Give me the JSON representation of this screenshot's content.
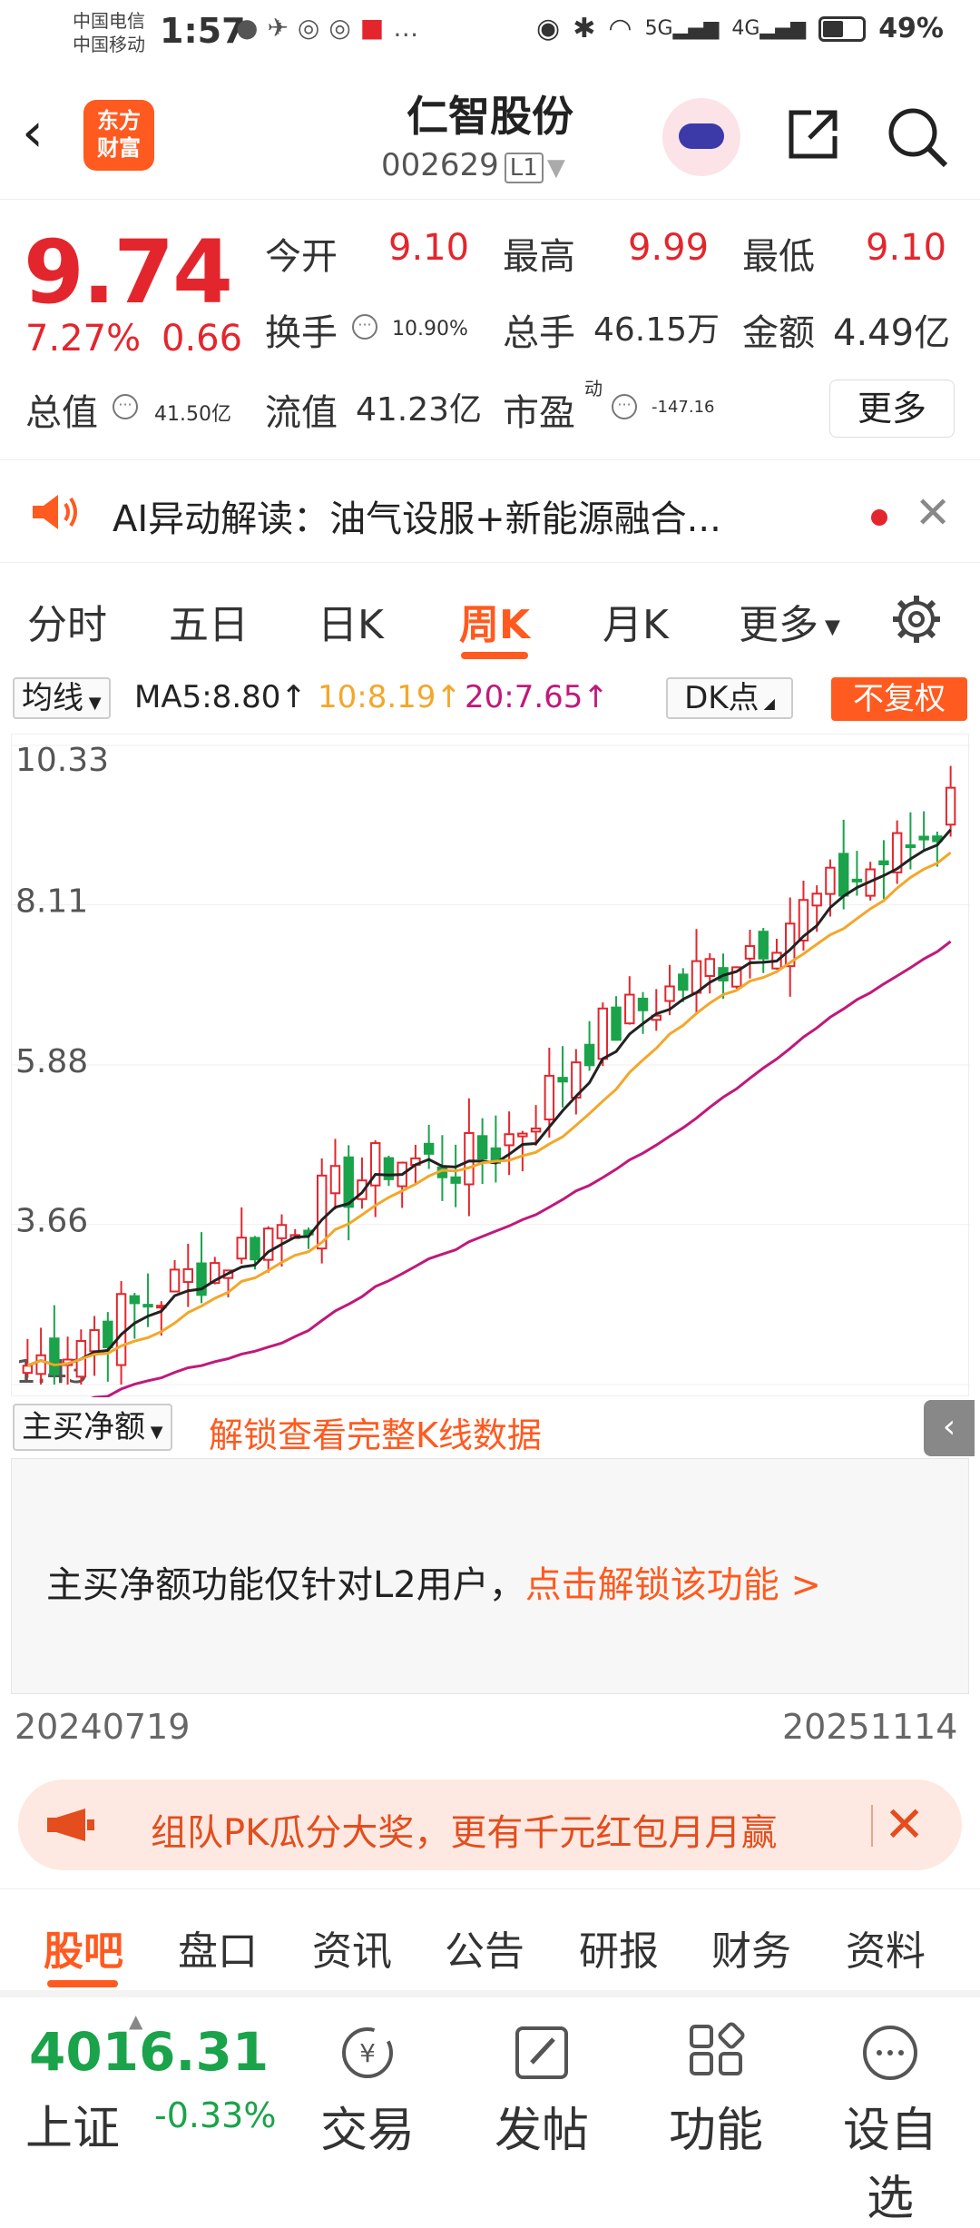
{
  "status_bar": {
    "carrier1": "中国电信",
    "carrier2": "中国移动",
    "time": "1:57",
    "battery": "49%",
    "icons": [
      "qq-icon",
      "signal-app-icon",
      "browser-icon",
      "browser-icon",
      "book-icon",
      "more-dots-icon",
      "eye-icon",
      "bluetooth-icon",
      "wifi-icon",
      "5g-signal-icon",
      "4g-signal-icon",
      "battery-icon"
    ]
  },
  "header": {
    "logo_line1": "东方",
    "logo_line2": "财富",
    "stock_name": "仁智股份",
    "stock_code": "002629",
    "level_badge": "L1"
  },
  "quote": {
    "price": "9.74",
    "change_pct": "7.27%",
    "change": "0.66",
    "open_label": "今开",
    "open": "9.10",
    "high_label": "最高",
    "high": "9.99",
    "low_label": "最低",
    "low": "9.10",
    "turnover_label": "换手",
    "turnover": "10.90%",
    "volume_label": "总手",
    "volume": "46.15万",
    "amount_label": "金额",
    "amount": "4.49亿",
    "mktcap_label": "总值",
    "mktcap": "41.50亿",
    "float_label": "流值",
    "float": "41.23亿",
    "pe_label": "市盈",
    "pe_sup": "动",
    "pe": "-147.16",
    "more_label": "更多",
    "up_color": "#e3262d"
  },
  "ai_bar": {
    "text": "AI异动解读：油气设服+新能源融合..."
  },
  "tabs": {
    "items": [
      "分时",
      "五日",
      "日K",
      "周K",
      "月K",
      "更多"
    ],
    "active": "周K"
  },
  "ma_bar": {
    "selector": "均线",
    "ma5": "MA5:8.80↑",
    "ma10": "10:8.19↑",
    "ma20": "20:7.65↑",
    "dk": "DK点",
    "adjust": "不复权"
  },
  "chart_data": {
    "type": "candlestick",
    "y_ticks": [
      "10.33",
      "8.11",
      "5.88",
      "3.66",
      "1.43"
    ],
    "ylim": [
      1.43,
      10.33
    ],
    "x_start": "20240719",
    "x_end": "20251114",
    "up_color": "#e3262d",
    "down_color": "#1aa34a",
    "ma_colors": {
      "ma5": "#222222",
      "ma10": "#f3a72a",
      "ma20": "#c0197a"
    }
  },
  "main_buy": {
    "selector": "主买净额",
    "unlock_link": "解锁查看完整K线数据",
    "notice": "主买净额功能仅针对L2用户，",
    "notice_link": "点击解锁该功能 >"
  },
  "banner": {
    "text": "组队PK瓜分大奖，更有千元红包月月赢"
  },
  "sub_tabs": {
    "items": [
      "股吧",
      "盘口",
      "资讯",
      "公告",
      "研报",
      "财务",
      "资料"
    ],
    "active": "股吧"
  },
  "bottom_bar": {
    "index_value": "4016.31",
    "index_name": "上证",
    "index_change": "-0.33%",
    "trade": "交易",
    "post": "发帖",
    "function": "功能",
    "add_watch": "设自选"
  }
}
